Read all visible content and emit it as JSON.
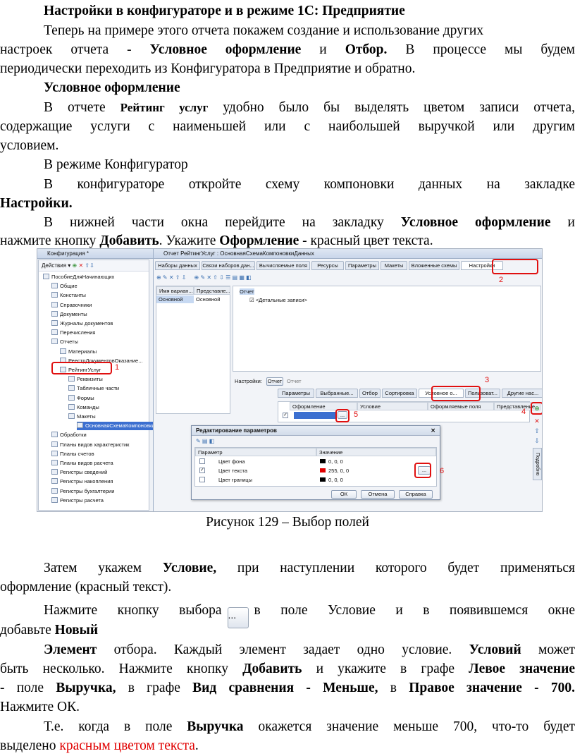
{
  "title": "Настройки в конфигураторе и в режиме 1С: Предприятие",
  "p1_a": "Теперь на примере этого отчета покажем создание и использование других",
  "p1_b_pre": "настроек отчета - ",
  "p1_b_b1": "Условное оформление",
  "p1_b_mid": " и ",
  "p1_b_b2": "Отбор.",
  "p1_b_post": " В процессе мы будем",
  "p1_c": "периодически переходить из Конфигуратора в Предприятие и обратно.",
  "h_cond": "Условное оформление",
  "p2_a_pre": "В отчете ",
  "p2_a_b": "Рейтинг услуг",
  "p2_a_post": " удобно было бы выделять цветом записи отчета,",
  "p2_b": "содержащие услуги с наименьшей или с наибольшей выручкой или другим",
  "p2_c": "условием.",
  "p3": "В режиме Конфигуратор",
  "p4_a": "В конфигураторе откройте схему компоновки данных на закладке",
  "p4_b": "Настройки.",
  "p5_a_pre": "В нижней части окна перейдите на закладку ",
  "p5_a_b": "Условное оформление",
  "p5_a_post": " и",
  "p5_b_pre": "нажмите кнопку ",
  "p5_b_b1": "Добавить",
  "p5_b_mid": ". Укажите ",
  "p5_b_b2": "Оформление",
  "p5_b_post": " - красный цвет текста.",
  "caption": "Рисунок 129 – Выбор полей",
  "p6_a_pre": "Затем укажем ",
  "p6_a_b": "Условие,",
  "p6_a_post": " при наступлении которого будет применяться",
  "p6_b": "оформление (красный текст).",
  "p7_a_pre": "Нажмите кнопку выбора",
  "p7_a_post": "в поле Условие и в появившемся окне",
  "p7_btn": "...",
  "p7_b_pre": "добавьте ",
  "p7_b_b": "Новый",
  "p8_a_b1": "Элемент",
  "p8_a_mid": " отбора. Каждый элемент задает одно условие. ",
  "p8_a_b2": "Условий",
  "p8_a_post": " может",
  "p8_b_pre": "быть несколько. Нажмите кнопку ",
  "p8_b_b1": "Добавить",
  "p8_b_mid": " и укажите в графе ",
  "p8_b_b2": "Левое значение",
  "p8_c_pre": "- поле ",
  "p8_c_b1": "Выручка,",
  "p8_c_mid1": " в графе ",
  "p8_c_b2": "Вид сравнения - Меньше,",
  "p8_c_mid2": " в ",
  "p8_c_b3": "Правое значение - 700.",
  "p8_d": "Нажмите ОК.",
  "p9_a_pre": "Т.е. когда в поле ",
  "p9_a_b": "Выручка",
  "p9_a_post": " окажется значение меньше 700, что-то будет",
  "p9_b_pre": "выделено ",
  "p9_b_red": "красным цветом текста",
  "p9_b_post": ".",
  "shot": {
    "left_title": "Конфигурация *",
    "left_toolbar": "Действия ▾",
    "tree": [
      "ПособиеДляНачинающих",
      "Общие",
      "Константы",
      "Справочники",
      "Документы",
      "Журналы документов",
      "Перечисления",
      "Отчеты",
      "Материалы",
      "РеестрДокументовОказание...",
      "РейтингУслуг",
      "Реквизиты",
      "Табличные части",
      "Формы",
      "Команды",
      "Макеты",
      "ОсновнаяСхемаКомпоновки",
      "Обработки",
      "Планы видов характеристик",
      "Планы счетов",
      "Планы видов расчета",
      "Регистры сведений",
      "Регистры накопления",
      "Регистры бухгалтерии",
      "Регистры расчета"
    ],
    "main_title": "Отчет РейтингУслуг : ОсновнаяСхемаКомпоновкиДанных",
    "tabs": [
      "Наборы данных",
      "Связи наборов дан...",
      "Вычисляемые поля",
      "Ресурсы",
      "Параметры",
      "Макеты",
      "Вложенные схемы",
      "Настройки"
    ],
    "variant_cols": [
      "Имя вариан...",
      "Представле..."
    ],
    "variant_row": [
      "Основной",
      "Основной"
    ],
    "struct_root": "Отчет",
    "struct_child": "<Детальные записи>",
    "settings_label": "Настройки:",
    "settings_btn1": "Отчет",
    "settings_btn2": "Отчет",
    "bottom_tabs": [
      "Параметры",
      "Выбранные...",
      "Отбор",
      "Сортировка",
      "Условное о...",
      "Пользоват...",
      "Другие нас..."
    ],
    "cond_cols": [
      "Оформление",
      "Условие",
      "Оформляемые поля",
      "Представление"
    ],
    "side_label": "Подробно",
    "dialog_title": "Редактирование параметров",
    "dialog_cols": [
      "Параметр",
      "Значение"
    ],
    "dialog_rows": [
      {
        "name": "Цвет фона",
        "value": "0, 0, 0",
        "color": "#000000"
      },
      {
        "name": "Цвет текста",
        "value": "255, 0, 0",
        "color": "#e00000"
      },
      {
        "name": "Цвет границы",
        "value": "0, 0, 0",
        "color": "#000000"
      }
    ],
    "ok": "ОК",
    "cancel": "Отмена",
    "help": "Справка",
    "ellipsis": "...",
    "marks": [
      "1",
      "2",
      "3",
      "4",
      "5",
      "6"
    ]
  }
}
